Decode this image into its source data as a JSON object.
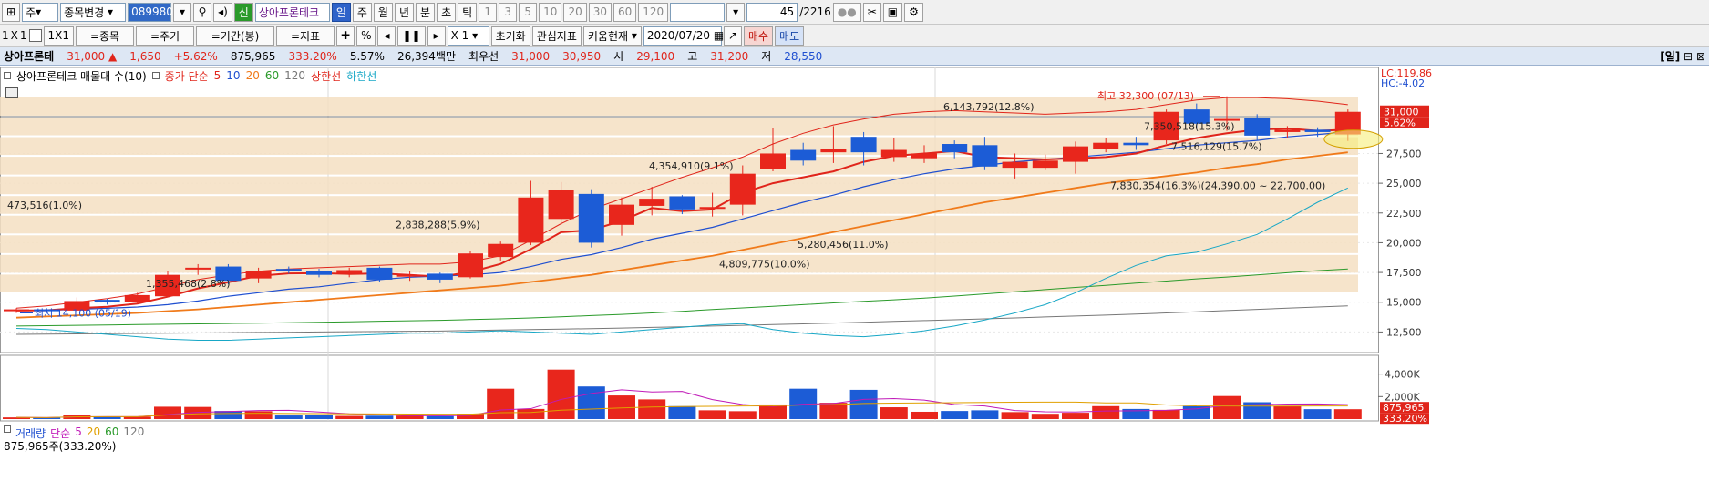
{
  "toolbar1": {
    "period_select": "주",
    "stock_change_label": "종목변경",
    "stock_code": "089980",
    "stock_name": "상아프론테크",
    "periods": [
      "일",
      "주",
      "월",
      "년",
      "분",
      "초",
      "틱"
    ],
    "active_period": "주",
    "intervals": [
      "1",
      "3",
      "5",
      "10",
      "20",
      "30",
      "60",
      "120"
    ],
    "page_value": "45",
    "page_total": "/2216"
  },
  "toolbar2": {
    "ratio_labels": [
      "1",
      "X",
      "1"
    ],
    "box_label": "1X1",
    "buttons": [
      "=종목",
      "=주기",
      "=기간(봉)",
      "=지표"
    ],
    "percent_label": "%",
    "x1_label": "X 1",
    "reset_label": "초기화",
    "interest_label": "관심지표",
    "kiwoom_label": "키움현재",
    "date": "2020/07/20",
    "buy_label": "매수",
    "sell_label": "매도"
  },
  "info_bar": {
    "name": "상아프론테",
    "price": "31,000",
    "arrow": "▲",
    "change": "1,650",
    "change_pct": "+5.62%",
    "volume": "875,965",
    "volume_ratio": "333.20%",
    "turnover": "5.57%",
    "amount": "26,394백만",
    "best_label": "최우선",
    "best_ask": "31,000",
    "best_bid": "30,950",
    "open_label": "시",
    "open": "29,100",
    "high_label": "고",
    "high": "31,200",
    "low_label": "저",
    "low": "28,550",
    "right_label": "[일]"
  },
  "legend": {
    "title": "상아프론테크 매물대 수(10)",
    "close_label": "종가 단순",
    "mas": [
      "5",
      "10",
      "20",
      "60",
      "120"
    ],
    "ma_colors": [
      "#e0251b",
      "#1f4fd0",
      "#f07a1a",
      "#2a9a2a",
      "#777777"
    ],
    "upper_label": "상한선",
    "lower_label": "하한선"
  },
  "volume_legend": {
    "title": "거래량",
    "simple_label": "단순",
    "mas": [
      "5",
      "20",
      "60",
      "120"
    ],
    "ma_colors": [
      "#c01ab8",
      "#e0a000",
      "#2a9a2a",
      "#777777"
    ],
    "note": "875,965주(333.20%)"
  },
  "right_axis": {
    "lc": "LC:119.86",
    "hc": "HC:-4.02",
    "price_tag": "31,000",
    "pct_tag": "5.62%",
    "ticks": [
      "27,500",
      "25,000",
      "22,500",
      "20,000",
      "17,500",
      "15,000",
      "12,500"
    ],
    "volume_ticks": [
      "4,000K",
      "2,000K"
    ],
    "volume_tag": "875,965",
    "volume_pct_tag": "333.20%"
  },
  "annotations": {
    "high": "최고 32,300 (07/13)",
    "low": "최저 14,100 (05/19)"
  },
  "colors": {
    "up": "#e8261c",
    "down": "#1c5cd6",
    "band": "#f5dfc2"
  },
  "chart_data": {
    "type": "candlestick",
    "y_unit": "원",
    "ylim": [
      11000,
      33200
    ],
    "candles": [
      {
        "o": 14300,
        "c": 14400,
        "h": 14500,
        "l": 14100
      },
      {
        "o": 14400,
        "c": 14300,
        "h": 14500,
        "l": 14200
      },
      {
        "o": 14300,
        "c": 15100,
        "h": 15400,
        "l": 14200
      },
      {
        "o": 15200,
        "c": 15000,
        "h": 15300,
        "l": 14800
      },
      {
        "o": 15000,
        "c": 15600,
        "h": 15800,
        "l": 14900
      },
      {
        "o": 15500,
        "c": 17300,
        "h": 17600,
        "l": 15400
      },
      {
        "o": 17800,
        "c": 17900,
        "h": 18200,
        "l": 17300
      },
      {
        "o": 18000,
        "c": 16800,
        "h": 18200,
        "l": 16500
      },
      {
        "o": 17000,
        "c": 17600,
        "h": 17900,
        "l": 16600
      },
      {
        "o": 17800,
        "c": 17600,
        "h": 18000,
        "l": 17400
      },
      {
        "o": 17600,
        "c": 17300,
        "h": 17800,
        "l": 17100
      },
      {
        "o": 17400,
        "c": 17700,
        "h": 17900,
        "l": 17100
      },
      {
        "o": 17900,
        "c": 16900,
        "h": 18000,
        "l": 16700
      },
      {
        "o": 17200,
        "c": 17300,
        "h": 17600,
        "l": 16800
      },
      {
        "o": 17400,
        "c": 16900,
        "h": 17500,
        "l": 16600
      },
      {
        "o": 17100,
        "c": 19100,
        "h": 19300,
        "l": 17000
      },
      {
        "o": 18800,
        "c": 19900,
        "h": 20100,
        "l": 18500
      },
      {
        "o": 20000,
        "c": 23800,
        "h": 25200,
        "l": 19800
      },
      {
        "o": 22000,
        "c": 24400,
        "h": 25100,
        "l": 21500
      },
      {
        "o": 24100,
        "c": 20000,
        "h": 24500,
        "l": 19600
      },
      {
        "o": 21500,
        "c": 23200,
        "h": 23800,
        "l": 20600
      },
      {
        "o": 23100,
        "c": 23700,
        "h": 24700,
        "l": 22300
      },
      {
        "o": 23900,
        "c": 22800,
        "h": 24000,
        "l": 22400
      },
      {
        "o": 22900,
        "c": 23000,
        "h": 24200,
        "l": 22200
      },
      {
        "o": 23200,
        "c": 25800,
        "h": 26500,
        "l": 22300
      },
      {
        "o": 26200,
        "c": 27500,
        "h": 29600,
        "l": 26000
      },
      {
        "o": 27800,
        "c": 26900,
        "h": 28400,
        "l": 26500
      },
      {
        "o": 27600,
        "c": 27900,
        "h": 29800,
        "l": 26700
      },
      {
        "o": 28900,
        "c": 27600,
        "h": 29300,
        "l": 26500
      },
      {
        "o": 27200,
        "c": 27800,
        "h": 28800,
        "l": 26800
      },
      {
        "o": 27100,
        "c": 27500,
        "h": 28200,
        "l": 26700
      },
      {
        "o": 28300,
        "c": 27600,
        "h": 28600,
        "l": 27100
      },
      {
        "o": 28200,
        "c": 26400,
        "h": 28900,
        "l": 26100
      },
      {
        "o": 26300,
        "c": 26800,
        "h": 27500,
        "l": 25400
      },
      {
        "o": 26300,
        "c": 26900,
        "h": 27400,
        "l": 26100
      },
      {
        "o": 26800,
        "c": 28100,
        "h": 28500,
        "l": 25800
      },
      {
        "o": 27900,
        "c": 28400,
        "h": 28800,
        "l": 27600
      },
      {
        "o": 28400,
        "c": 28200,
        "h": 28900,
        "l": 27800
      },
      {
        "o": 28600,
        "c": 31000,
        "h": 31200,
        "l": 28300
      },
      {
        "o": 31200,
        "c": 30000,
        "h": 31700,
        "l": 29600
      },
      {
        "o": 30300,
        "c": 30400,
        "h": 32300,
        "l": 29400
      },
      {
        "o": 30500,
        "c": 29000,
        "h": 30800,
        "l": 28600
      },
      {
        "o": 29300,
        "c": 29500,
        "h": 29800,
        "l": 28800
      },
      {
        "o": 29500,
        "c": 29300,
        "h": 29700,
        "l": 28900
      },
      {
        "o": 29100,
        "c": 31000,
        "h": 31200,
        "l": 28550
      }
    ],
    "ma5": [
      14300,
      14320,
      14500,
      14620,
      14880,
      15460,
      16160,
      16680,
      17220,
      17420,
      17440,
      17380,
      17420,
      17300,
      17140,
      17540,
      18220,
      19460,
      20880,
      21060,
      21840,
      22920,
      22660,
      22800,
      24200,
      25000,
      25500,
      26000,
      26800,
      27300,
      27500,
      27700,
      27200,
      27100,
      27000,
      27100,
      27200,
      27500,
      28200,
      28800,
      29200,
      29500,
      29600,
      29400,
      29500
    ],
    "ma10": [
      14300,
      14310,
      14410,
      14490,
      14600,
      14800,
      15100,
      15500,
      15800,
      16100,
      16300,
      16600,
      16900,
      17100,
      17200,
      17300,
      17500,
      18000,
      18600,
      19000,
      19600,
      20300,
      20800,
      21300,
      22000,
      22700,
      23400,
      24000,
      24700,
      25300,
      25800,
      26200,
      26500,
      26800,
      27000,
      27200,
      27400,
      27600,
      27900,
      28200,
      28400,
      28600,
      28900,
      29100,
      29300
    ],
    "ma20": [
      13700,
      13800,
      13900,
      14000,
      14100,
      14250,
      14400,
      14600,
      14800,
      15000,
      15200,
      15400,
      15600,
      15800,
      16000,
      16200,
      16400,
      16700,
      17000,
      17300,
      17700,
      18100,
      18500,
      18900,
      19400,
      19900,
      20400,
      20900,
      21400,
      21900,
      22400,
      22900,
      23400,
      23800,
      24200,
      24600,
      25000,
      25300,
      25600,
      25900,
      26300,
      26600,
      27000,
      27300,
      27600
    ],
    "ma60": [
      13000,
      13030,
      13060,
      13090,
      13120,
      13150,
      13180,
      13210,
      13240,
      13280,
      13320,
      13360,
      13400,
      13440,
      13480,
      13540,
      13600,
      13680,
      13780,
      13880,
      13980,
      14100,
      14240,
      14380,
      14520,
      14660,
      14800,
      14940,
      15080,
      15200,
      15350,
      15520,
      15700,
      15880,
      16060,
      16240,
      16420,
      16600,
      16780,
      16960,
      17120,
      17300,
      17480,
      17650,
      17800
    ],
    "ma120": [
      12300,
      12320,
      12340,
      12360,
      12380,
      12400,
      12420,
      12440,
      12460,
      12480,
      12500,
      12520,
      12540,
      12560,
      12580,
      12620,
      12660,
      12700,
      12740,
      12780,
      12830,
      12880,
      12940,
      13000,
      13060,
      13120,
      13180,
      13250,
      13320,
      13390,
      13460,
      13530,
      13600,
      13680,
      13760,
      13840,
      13920,
      14000,
      14100,
      14200,
      14300,
      14400,
      14500,
      14600,
      14700
    ],
    "lower_band": [
      12800,
      12700,
      12500,
      12300,
      12100,
      11900,
      11800,
      11800,
      11900,
      12000,
      12100,
      12200,
      12300,
      12400,
      12400,
      12500,
      12600,
      12500,
      12400,
      12300,
      12500,
      12700,
      12900,
      13100,
      13200,
      12700,
      12400,
      12200,
      12100,
      12300,
      12600,
      13000,
      13500,
      14100,
      14800,
      15800,
      17000,
      18100,
      18900,
      19200,
      19900,
      20700,
      22000,
      23400,
      24600
    ],
    "upper_band": [
      14500,
      14700,
      15000,
      15300,
      15700,
      16300,
      16900,
      17300,
      17600,
      17800,
      17900,
      18000,
      18100,
      18200,
      18200,
      18400,
      18900,
      20200,
      21600,
      22800,
      23700,
      24600,
      25500,
      26300,
      27200,
      28300,
      29200,
      29900,
      30400,
      30800,
      31000,
      31100,
      31000,
      30900,
      30800,
      30900,
      31000,
      31200,
      31600,
      32000,
      32200,
      32200,
      32100,
      31900,
      31600
    ],
    "volume_profile": [
      {
        "label": "6,143,792(12.8%)",
        "low": 30600,
        "high": 32300
      },
      {
        "label": "7,350,518(15.3%)",
        "low": 28950,
        "high": 30600
      },
      {
        "label": "7,516,129(15.7%)",
        "low": 27300,
        "high": 28950
      },
      {
        "label": "4,354,910(9.1%)",
        "low": 25650,
        "high": 27300
      },
      {
        "label": "7,830,354(16.3%)(24,390.00 ~ 22,700.00)",
        "low": 24000,
        "high": 25650
      },
      {
        "label": "473,516(1.0%)",
        "low": 22350,
        "high": 24000
      },
      {
        "label": "2,838,288(5.9%)",
        "low": 20700,
        "high": 22350
      },
      {
        "label": "5,280,456(11.0%)",
        "low": 19050,
        "high": 20700
      },
      {
        "label": "4,809,775(10.0%)",
        "low": 17400,
        "high": 19050
      },
      {
        "label": "1,355,468(2.8%)",
        "low": 15750,
        "high": 17400
      }
    ],
    "volume": [
      150,
      120,
      350,
      240,
      220,
      1100,
      1080,
      720,
      700,
      320,
      330,
      280,
      300,
      300,
      260,
      480,
      2700,
      900,
      4400,
      2900,
      2100,
      1750,
      1150,
      780,
      700,
      1300,
      2700,
      1450,
      2600,
      1050,
      650,
      720,
      780,
      620,
      470,
      560,
      1150,
      900,
      820,
      1150,
      2050,
      1500,
      1150,
      880,
      876
    ]
  }
}
